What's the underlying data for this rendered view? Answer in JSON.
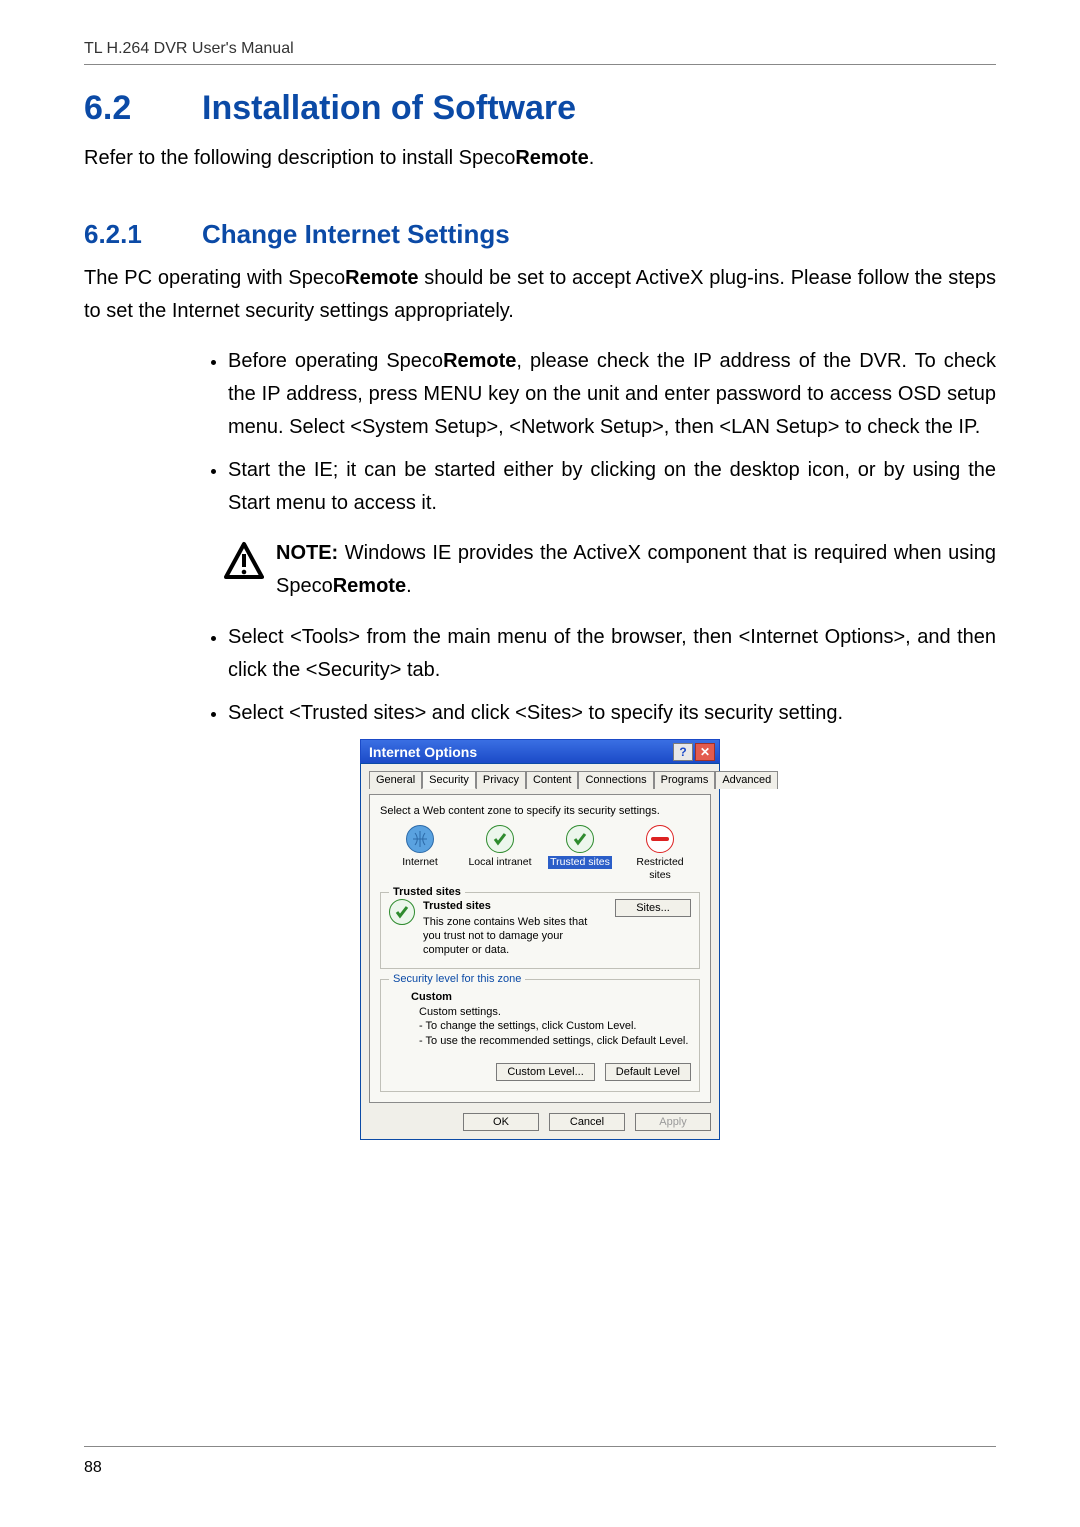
{
  "doc": {
    "header": "TL H.264 DVR User's Manual",
    "page_number": "88"
  },
  "section": {
    "num": "6.2",
    "title": "Installation of Software",
    "intro_pre": "Refer to the following description to install Speco",
    "intro_bold": "Remote",
    "intro_post": "."
  },
  "subsection": {
    "num": "6.2.1",
    "title": "Change Internet Settings",
    "p1_a": "The PC operating with Speco",
    "p1_bold": "Remote",
    "p1_b": " should be set to accept ActiveX plug-ins. Please follow the steps to set the Internet security settings appropriately.",
    "b1_a": "Before operating Speco",
    "b1_bold": "Remote",
    "b1_b": ", please check the IP address of the DVR. To check the IP address, press MENU key on the unit and enter password to access OSD setup menu. Select <System Setup>, <Network Setup>, then <LAN Setup> to check the IP.",
    "b2": "Start the IE; it can be started either by clicking on the desktop icon, or by using the Start menu to access it.",
    "note_label": "NOTE:",
    "note_a": " Windows IE provides the ActiveX component that is required when using Speco",
    "note_bold": "Remote",
    "note_b": ".",
    "b3": "Select <Tools> from the main menu of the browser, then <Internet Options>, and then click the <Security> tab.",
    "b4": "Select <Trusted sites> and click <Sites> to specify its security setting."
  },
  "dialog": {
    "title": "Internet Options",
    "tabs": [
      "General",
      "Security",
      "Privacy",
      "Content",
      "Connections",
      "Programs",
      "Advanced"
    ],
    "active_tab_index": 1,
    "zone_instruction": "Select a Web content zone to specify its security settings.",
    "zones": {
      "internet": "Internet",
      "local_intranet": "Local intranet",
      "trusted_sites": "Trusted sites",
      "restricted_sites": "Restricted sites"
    },
    "selected_zone_index": 2,
    "trusted_group": {
      "title": "Trusted sites",
      "desc": "This zone contains Web sites that you trust not to damage your computer or data.",
      "sites_btn": "Sites..."
    },
    "security_level": {
      "group_title": "Security level for this zone",
      "custom_title": "Custom",
      "line1": "Custom settings.",
      "line2": "- To change the settings, click Custom Level.",
      "line3": "- To use the recommended settings, click Default Level.",
      "custom_level_btn": "Custom Level...",
      "default_level_btn": "Default Level"
    },
    "footer": {
      "ok": "OK",
      "cancel": "Cancel",
      "apply": "Apply"
    }
  }
}
